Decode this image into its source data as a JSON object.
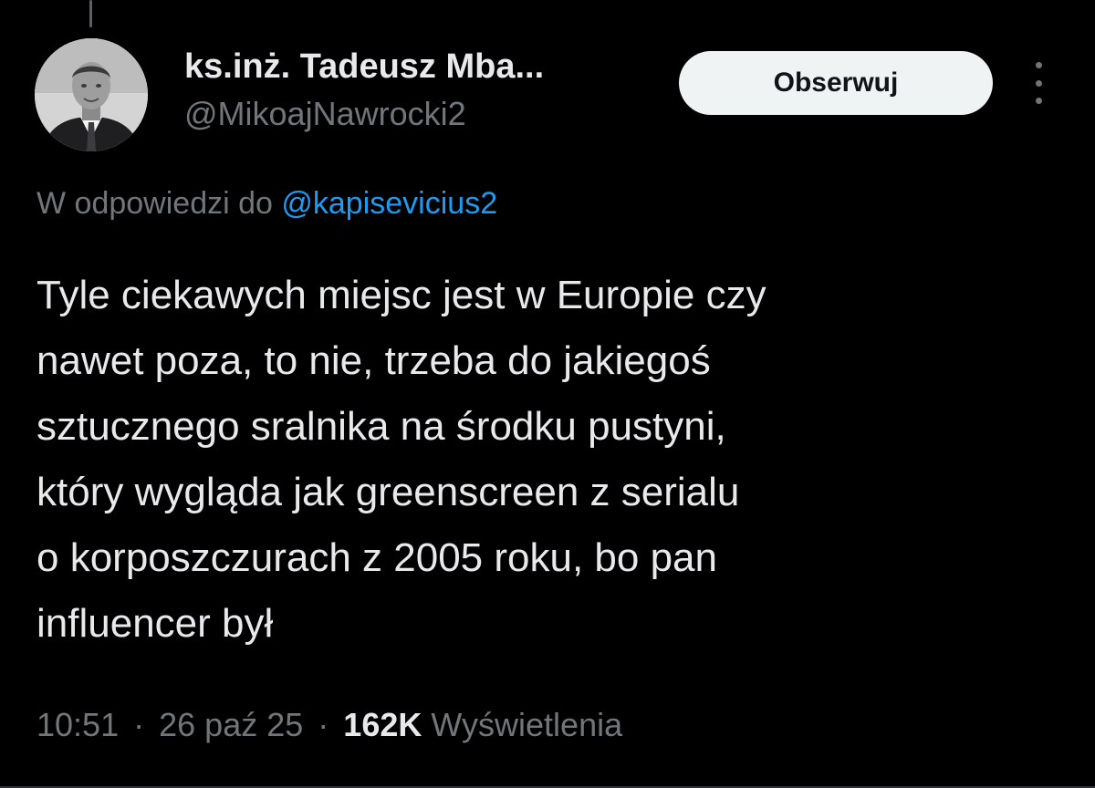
{
  "author": {
    "display_name": "ks.inż. Tadeusz Mba...",
    "handle": "@MikoajNawrocki2",
    "avatar_icon": "user-avatar-photo"
  },
  "follow_button": {
    "label": "Obserwuj"
  },
  "more_icon": "more-vertical-icon",
  "reply_context": {
    "prefix": "W odpowiedzi do",
    "mention": "@kapisevicius2"
  },
  "tweet": {
    "lines": [
      "Tyle ciekawych miejsc jest w Europie czy",
      "nawet poza, to nie, trzeba do jakiegoś",
      "sztucznego sralnika na środku pustyni,",
      "który wygląda jak greenscreen z serialu",
      "o korposzczurach z 2005 roku, bo pan",
      "influencer był"
    ]
  },
  "meta": {
    "time": "10:51",
    "separator": "·",
    "date": "26 paź 25",
    "views_count": "162K",
    "views_label": "Wyświetlenia"
  },
  "colors": {
    "background": "#000000",
    "text_primary": "#e7e9ea",
    "text_secondary": "#71767b",
    "link": "#1d9bf0",
    "button_bg": "#eff3f4",
    "button_text": "#0f1419"
  }
}
